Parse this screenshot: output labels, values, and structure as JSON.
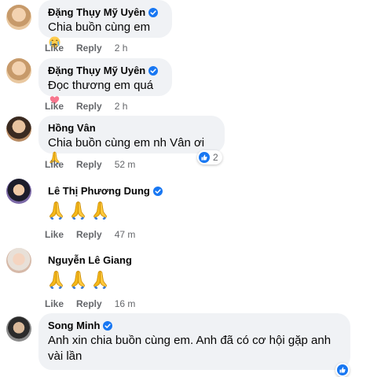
{
  "comments": [
    {
      "author": "Đặng Thụy Mỹ Uyên",
      "verified": true,
      "text": "Chia buồn cùng em",
      "emoji": "crying-face-icon",
      "like": "Like",
      "reply": "Reply",
      "time": "2 h"
    },
    {
      "author": "Đặng Thụy Mỹ Uyên",
      "verified": true,
      "text": "Đọc thương em quá",
      "emoji": "heart-icon",
      "like": "Like",
      "reply": "Reply",
      "time": "2 h"
    },
    {
      "author": "Hồng Vân",
      "verified": false,
      "text": "Chia buồn cùng em nh Vân ơi",
      "emoji": "folded-hands-icon",
      "like": "Like",
      "reply": "Reply",
      "time": "52 m",
      "reaction_count": "2"
    },
    {
      "author": "Lê Thị Phương Dung",
      "verified": true,
      "emojis": [
        "folded-hands-icon",
        "folded-hands-icon",
        "folded-hands-icon"
      ],
      "like": "Like",
      "reply": "Reply",
      "time": "47 m"
    },
    {
      "author": "Nguyễn Lê Giang",
      "verified": false,
      "emojis": [
        "folded-hands-icon",
        "folded-hands-icon",
        "folded-hands-icon"
      ],
      "like": "Like",
      "reply": "Reply",
      "time": "16 m"
    },
    {
      "author": "Song Minh",
      "verified": true,
      "text_line1": "Anh xin chia buồn cùng em. Anh đã có cơ hội gặp anh",
      "text_line2": "vài lần"
    }
  ],
  "colors": {
    "bubble": "#f0f2f5",
    "meta": "#65676b",
    "verified": "#1877f2",
    "like_reaction": "#1877f2"
  }
}
